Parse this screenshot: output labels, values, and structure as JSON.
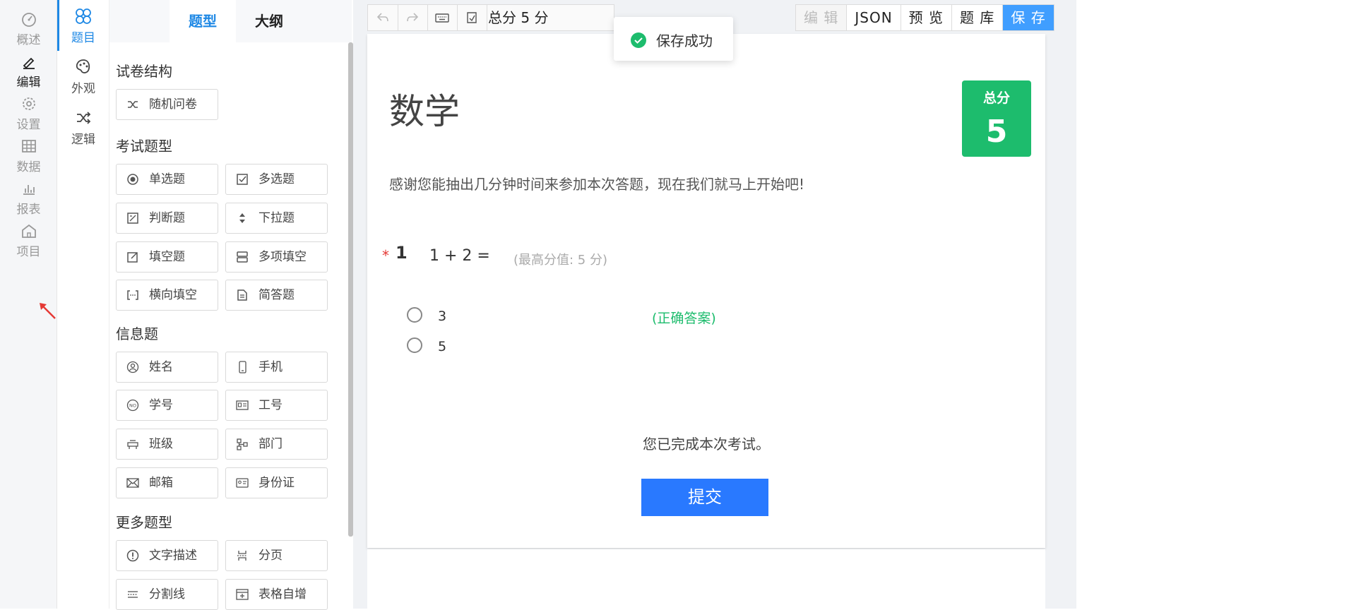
{
  "main_nav": [
    {
      "label": "概述",
      "icon": "dashboard-icon",
      "active": false
    },
    {
      "label": "编辑",
      "icon": "pencil-icon",
      "active": true
    },
    {
      "label": "设置",
      "icon": "gear-icon",
      "active": false
    },
    {
      "label": "数据",
      "icon": "table-icon",
      "active": false
    },
    {
      "label": "报表",
      "icon": "bar-chart-icon",
      "active": false
    },
    {
      "label": "项目",
      "icon": "home-icon",
      "active": false
    }
  ],
  "sub_nav": [
    {
      "label": "题目",
      "icon": "question-icon",
      "active": true
    },
    {
      "label": "外观",
      "icon": "palette-icon",
      "active": false
    },
    {
      "label": "逻辑",
      "icon": "shuffle-icon",
      "active": false
    }
  ],
  "tabs": [
    {
      "label": "题型",
      "active": true
    },
    {
      "label": "大纲",
      "active": false
    }
  ],
  "palette": {
    "exam_structure": {
      "title": "试卷结构",
      "items": [
        {
          "label": "随机问卷",
          "icon": "shuffle-icon"
        }
      ]
    },
    "exam_types": {
      "title": "考试题型",
      "items": [
        {
          "label": "单选题",
          "icon": "radio-icon"
        },
        {
          "label": "多选题",
          "icon": "checkbox-icon"
        },
        {
          "label": "判断题",
          "icon": "judge-icon"
        },
        {
          "label": "下拉题",
          "icon": "dropdown-icon"
        },
        {
          "label": "填空题",
          "icon": "edit-icon"
        },
        {
          "label": "多项填空",
          "icon": "multi-fill-icon"
        },
        {
          "label": "横向填空",
          "icon": "bracket-icon"
        },
        {
          "label": "简答题",
          "icon": "document-icon"
        }
      ]
    },
    "info_types": {
      "title": "信息题",
      "items": [
        {
          "label": "姓名",
          "icon": "user-icon"
        },
        {
          "label": "手机",
          "icon": "phone-icon"
        },
        {
          "label": "学号",
          "icon": "no-icon"
        },
        {
          "label": "工号",
          "icon": "badge-icon"
        },
        {
          "label": "班级",
          "icon": "class-icon"
        },
        {
          "label": "部门",
          "icon": "department-icon"
        },
        {
          "label": "邮箱",
          "icon": "mail-icon"
        },
        {
          "label": "身份证",
          "icon": "id-card-icon"
        }
      ]
    },
    "more_types": {
      "title": "更多题型",
      "items": [
        {
          "label": "文字描述",
          "icon": "info-icon"
        },
        {
          "label": "分页",
          "icon": "page-break-icon"
        },
        {
          "label": "分割线",
          "icon": "divider-icon"
        },
        {
          "label": "表格自增",
          "icon": "table-add-icon"
        }
      ]
    }
  },
  "toolbar": {
    "total_label": "总分 5 分",
    "buttons": [
      "编 辑",
      "JSON",
      "预 览",
      "题 库",
      "保 存"
    ]
  },
  "toast": {
    "text": "保存成功"
  },
  "paper": {
    "title": "数学",
    "score_label": "总分",
    "score_value": "5",
    "description": "感谢您能抽出几分钟时间来参加本次答题，现在我们就马上开始吧!",
    "question": {
      "required_mark": "*",
      "number": "1",
      "text": "1 + 2 =",
      "max_score": "(最高分值: 5 分)",
      "options": [
        {
          "label": "3",
          "correct": true
        },
        {
          "label": "5",
          "correct": false
        }
      ],
      "correct_label": "(正确答案)"
    },
    "completion_text": "您已完成本次考试。",
    "submit_label": "提交"
  }
}
